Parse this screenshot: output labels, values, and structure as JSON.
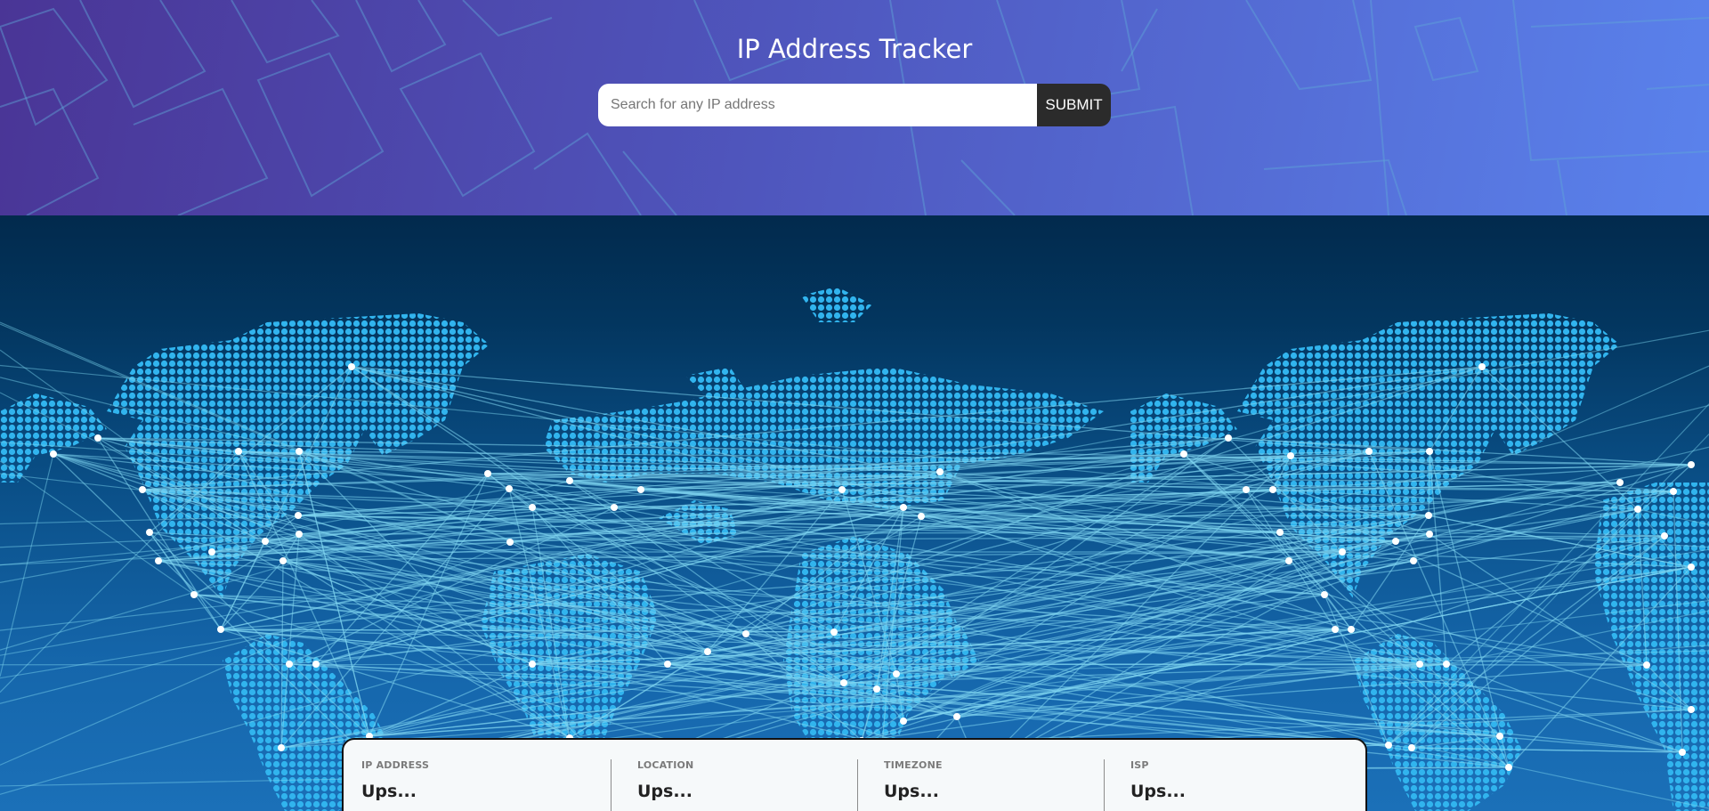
{
  "header": {
    "title": "IP Address Tracker",
    "background_gradient": [
      "#4a3596",
      "#4f56bd",
      "#5a82ec"
    ]
  },
  "search": {
    "placeholder": "Search for any IP address",
    "value": "",
    "submit_label": "SUBMIT"
  },
  "map": {
    "background_gradient": [
      "#022a4d",
      "#0a4f87",
      "#1b70b8"
    ],
    "dot_color": "#31b4ee",
    "node_color": "#ffffff",
    "line_color": "#7fd6f0"
  },
  "info": {
    "ip_address": {
      "label": "IP ADDRESS",
      "value": "Ups..."
    },
    "location": {
      "label": "LOCATION",
      "value": "Ups..."
    },
    "timezone": {
      "label": "TIMEZONE",
      "value": "Ups..."
    },
    "isp": {
      "label": "ISP",
      "value": "Ups..."
    }
  }
}
